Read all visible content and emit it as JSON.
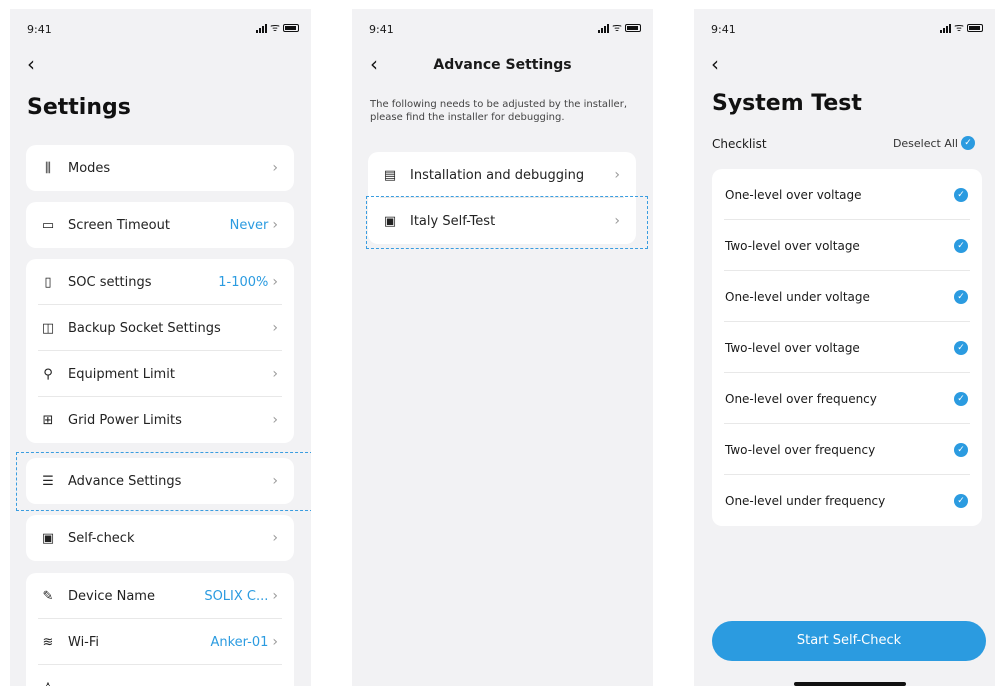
{
  "status": {
    "time": "9:41"
  },
  "settings": {
    "title": "Settings",
    "groups": [
      [
        {
          "icon": "modes-icon",
          "glyph": "⫼",
          "label": "Modes",
          "value": ""
        }
      ],
      [
        {
          "icon": "screen-icon",
          "glyph": "▭",
          "label": "Screen Timeout",
          "value": "Never"
        }
      ],
      [
        {
          "icon": "battery-icon",
          "glyph": "▯",
          "label": "SOC settings",
          "value": "1-100%"
        },
        {
          "icon": "socket-icon",
          "glyph": "◫",
          "label": "Backup Socket Settings",
          "value": ""
        },
        {
          "icon": "equipment-icon",
          "glyph": "⚲",
          "label": "Equipment Limit",
          "value": ""
        },
        {
          "icon": "grid-icon",
          "glyph": "⊞",
          "label": "Grid Power Limits",
          "value": ""
        }
      ],
      [
        {
          "icon": "advance-icon",
          "glyph": "☰",
          "label": "Advance Settings",
          "value": ""
        }
      ],
      [
        {
          "icon": "selfcheck-icon",
          "glyph": "▣",
          "label": "Self-check",
          "value": ""
        }
      ],
      [
        {
          "icon": "pen-icon",
          "glyph": "✎",
          "label": "Device Name",
          "value": "SOLIX C..."
        },
        {
          "icon": "wifi-icon",
          "glyph": "≋",
          "label": "Wi-Fi",
          "value": "Anker-01"
        },
        {
          "icon": "more-icon",
          "glyph": "♙",
          "label": "",
          "value": ""
        }
      ]
    ]
  },
  "advance": {
    "title": "Advance Settings",
    "description": "The following needs to be adjusted by the installer, please find the installer for debugging.",
    "items": [
      {
        "icon": "install-icon",
        "glyph": "▤",
        "label": "Installation and debugging"
      },
      {
        "icon": "selftest-icon",
        "glyph": "▣",
        "label": "Italy Self-Test"
      }
    ]
  },
  "system_test": {
    "title": "System Test",
    "checklist_label": "Checklist",
    "deselect_label": "Deselect All",
    "items": [
      "One-level over voltage",
      "Two-level over voltage",
      "One-level under voltage",
      "Two-level over voltage",
      "One-level over frequency",
      "Two-level over frequency",
      "One-level under frequency"
    ],
    "button_label": "Start Self-Check"
  }
}
